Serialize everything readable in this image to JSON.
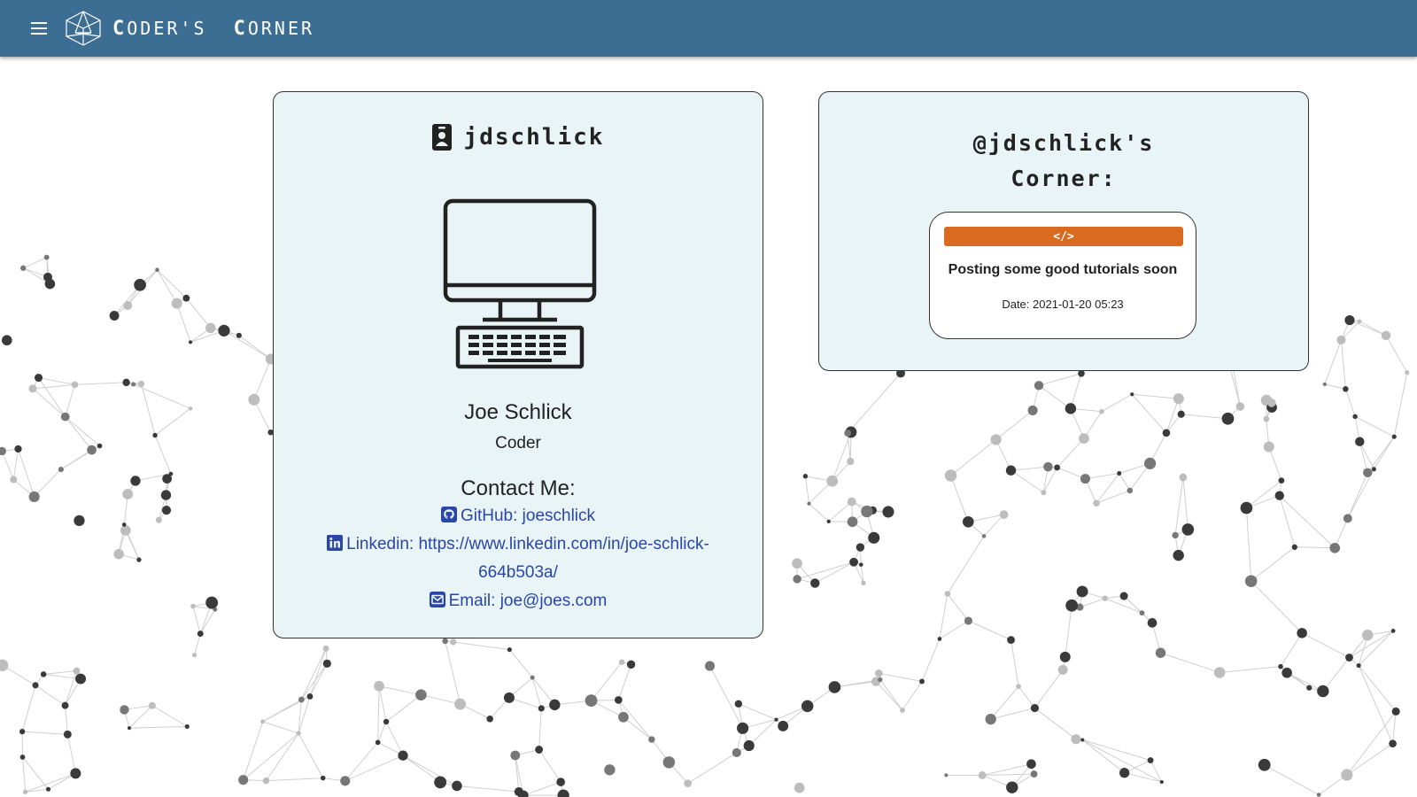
{
  "header": {
    "brand_first": "C",
    "brand_first_rest": "ODER'S",
    "brand_second": "C",
    "brand_second_rest": "ORNER",
    "menu_icon": "hamburger-menu-icon",
    "logo_icon": "geodesic-sphere-logo"
  },
  "profile": {
    "username": "jdschlick",
    "username_icon": "id-badge-icon",
    "avatar_icon": "desktop-computer-icon",
    "full_name": "Joe Schlick",
    "role": "Coder",
    "contact_title": "Contact Me:",
    "github_label": "GitHub: joeschlick",
    "linkedin_label": "Linkedin: https://www.linkedin.com/in/joe-schlick-664b503a/",
    "email_label": "Email: joe@joes.com"
  },
  "corner": {
    "title_line1": "@jdschlick's",
    "title_line2": "Corner:",
    "posts": [
      {
        "badge": "</>",
        "title": "Posting some good tutorials soon",
        "date": "Date: 2021-01-20 05:23"
      }
    ]
  },
  "colors": {
    "header": "#3b6e92",
    "card_bg": "#e8f4f6",
    "link": "#2a46a8",
    "post_badge": "#d96a1f"
  }
}
